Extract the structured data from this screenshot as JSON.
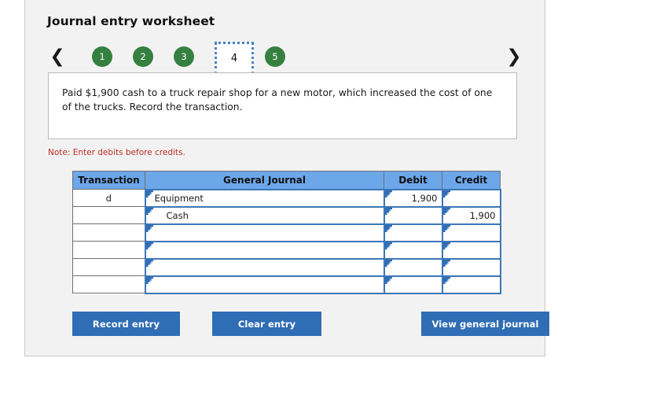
{
  "worksheet": {
    "title": "Journal entry worksheet",
    "note": "Note: Enter debits before credits."
  },
  "pager": {
    "prev_label": "‹",
    "next_label": "›",
    "steps": [
      {
        "label": "1",
        "state": "complete"
      },
      {
        "label": "2",
        "state": "complete"
      },
      {
        "label": "3",
        "state": "complete"
      },
      {
        "label": "4",
        "state": "active"
      },
      {
        "label": "5",
        "state": "complete"
      }
    ]
  },
  "description": {
    "text": "Paid $1,900 cash to a truck repair shop for a new motor, which increased the cost of one of the trucks. Record the transaction."
  },
  "table": {
    "headers": [
      "Transaction",
      "General Journal",
      "Debit",
      "Credit"
    ],
    "rows": [
      {
        "transaction": "d",
        "account": "Equipment",
        "indent": false,
        "debit": "1,900",
        "credit": ""
      },
      {
        "transaction": "",
        "account": "Cash",
        "indent": true,
        "debit": "",
        "credit": "1,900"
      },
      {
        "transaction": "",
        "account": "",
        "indent": false,
        "debit": "",
        "credit": ""
      },
      {
        "transaction": "",
        "account": "",
        "indent": false,
        "debit": "",
        "credit": ""
      },
      {
        "transaction": "",
        "account": "",
        "indent": false,
        "debit": "",
        "credit": ""
      },
      {
        "transaction": "",
        "account": "",
        "indent": false,
        "debit": "",
        "credit": ""
      }
    ]
  },
  "buttons": {
    "record": "Record entry",
    "clear": "Clear entry",
    "view_journal": "View general journal"
  },
  "colors": {
    "panel_bg": "#f2f2f2",
    "header_blue": "#6ca7ea",
    "button_blue": "#2f6db5",
    "step_green": "#358040",
    "note_red": "#bd2d24",
    "cell_border_blue": "#3c76b8"
  }
}
